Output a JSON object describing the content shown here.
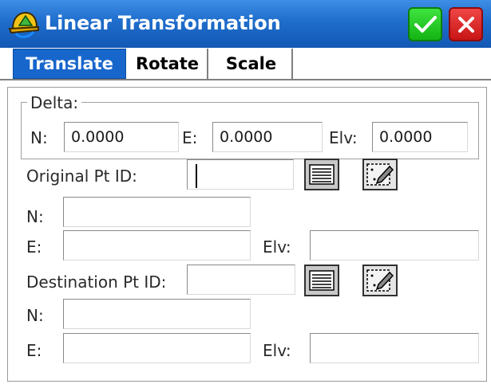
{
  "window": {
    "title": "Linear Transformation"
  },
  "tabs": [
    {
      "label": "Translate",
      "active": true
    },
    {
      "label": "Rotate",
      "active": false
    },
    {
      "label": "Scale",
      "active": false
    }
  ],
  "delta": {
    "group_label": "Delta:",
    "n_label": "N:",
    "n_value": "0.0000",
    "e_label": "E:",
    "e_value": "0.0000",
    "elv_label": "Elv:",
    "elv_value": "0.0000"
  },
  "original": {
    "label": "Original Pt ID:",
    "pt_id": "",
    "n_label": "N:",
    "n_value": "",
    "e_label": "E:",
    "e_value": "",
    "elv_label": "Elv:",
    "elv_value": ""
  },
  "destination": {
    "label": "Destination Pt ID:",
    "pt_id": "",
    "n_label": "N:",
    "n_value": "",
    "e_label": "E:",
    "e_value": "",
    "elv_label": "Elv:",
    "elv_value": ""
  },
  "icons": {
    "app": "hardhat-icon",
    "ok": "checkmark-icon",
    "close": "x-icon",
    "list": "list-icon",
    "map": "map-pick-icon"
  },
  "colors": {
    "titlebar": "#1f6dcc",
    "active_tab": "#1766cc",
    "ok_button": "#13b413",
    "close_button": "#c81414"
  }
}
